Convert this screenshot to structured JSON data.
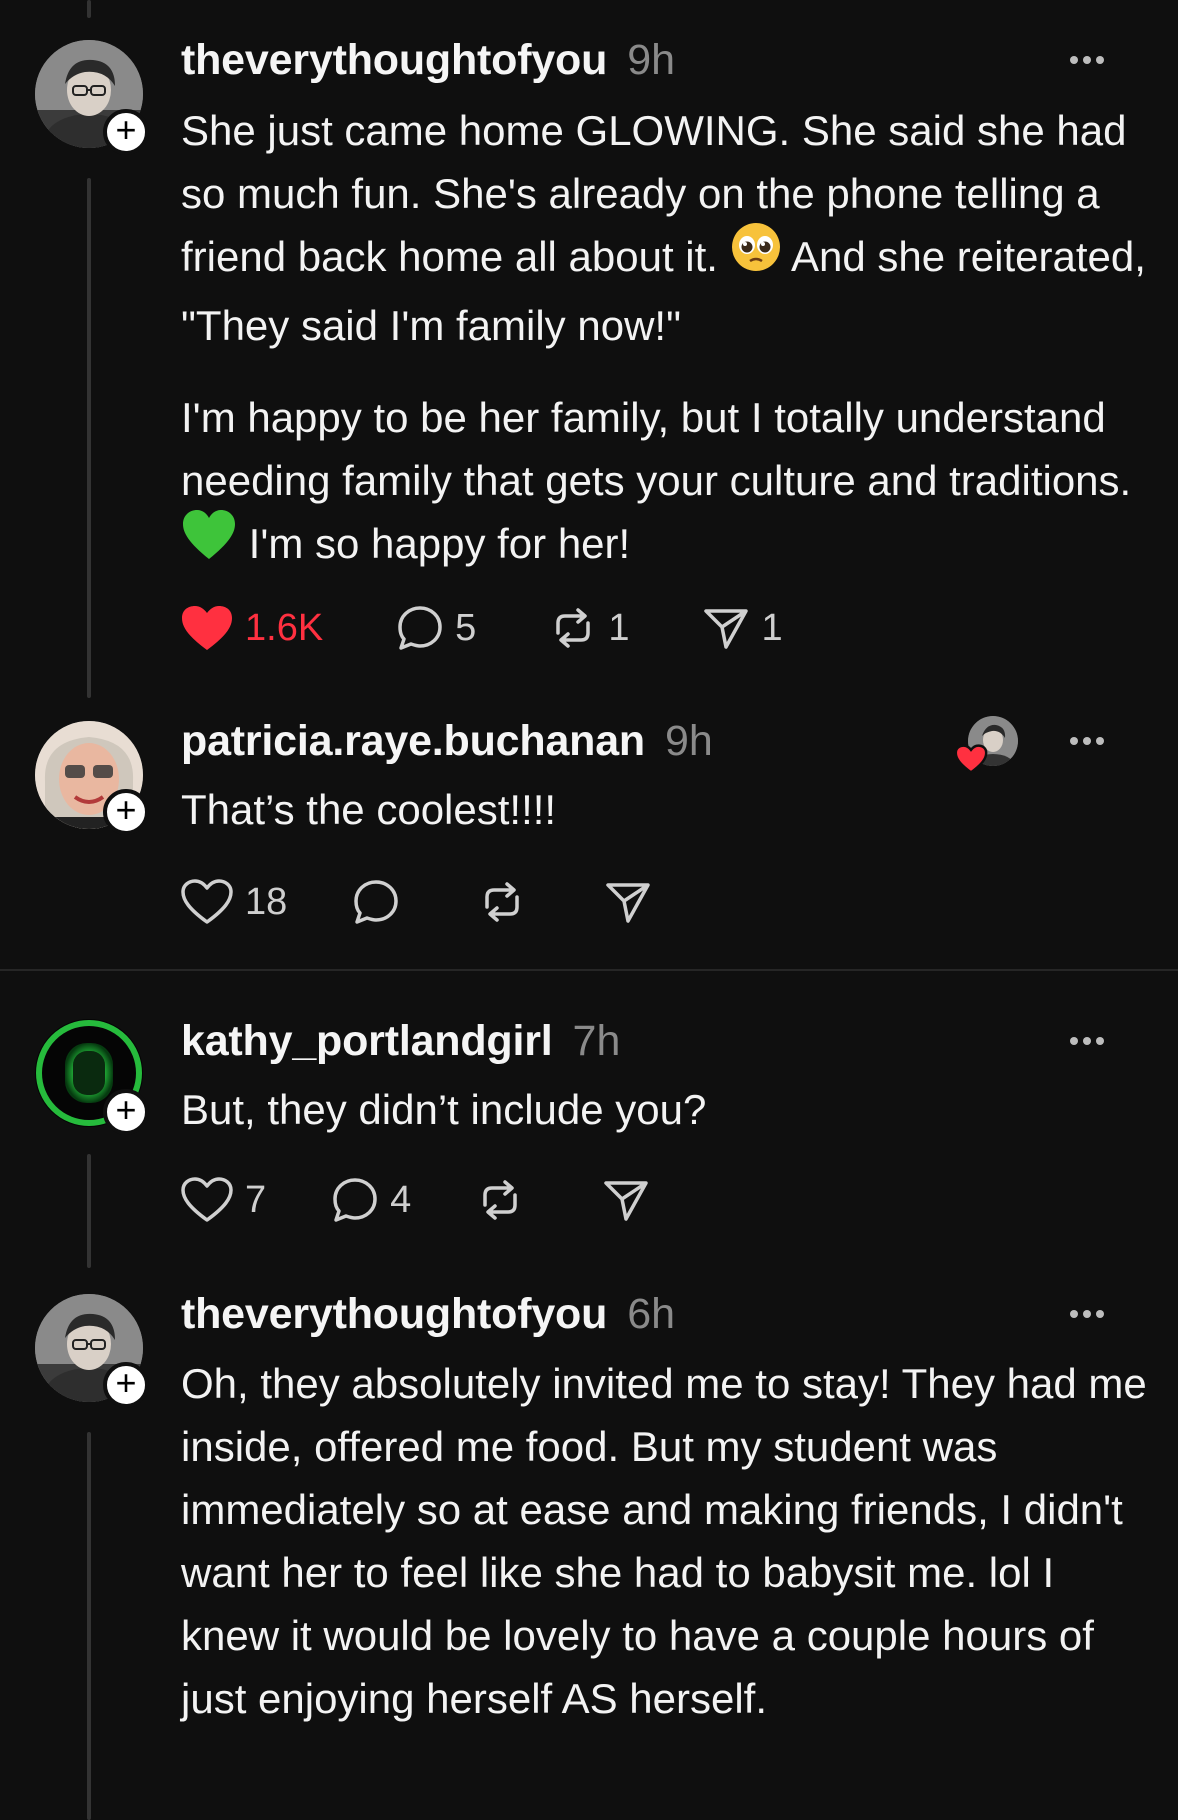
{
  "posts": [
    {
      "username": "theverythoughtofyou",
      "time": "9h",
      "avatar": "person-with-glasses-avatar",
      "paragraph1_a": "She just came home GLOWING. She said she had so much fun. She's already on the phone telling a friend back home all about it.",
      "paragraph1_emoji": "pleading-face-emoji",
      "paragraph1_b": " And she reiterated, \"They said I'm family now!\"",
      "paragraph2_a": "I'm happy to be her family, but I totally understand needing family that gets your culture and traditions.",
      "paragraph2_emoji": "green-heart-emoji",
      "paragraph2_b": " I'm so happy for her!",
      "likes": "1.6K",
      "liked": true,
      "replies": "5",
      "reposts": "1",
      "shares": "1"
    },
    {
      "username": "patricia.raye.buchanan",
      "time": "9h",
      "avatar": "woman-with-glasses-avatar",
      "text": "That’s the coolest!!!!",
      "likes": "18",
      "liked_by_author": true
    },
    {
      "username": "kathy_portlandgirl",
      "time": "7h",
      "avatar": "green-glow-avatar",
      "text": "But, they didn’t include you?",
      "likes": "7",
      "replies": "4"
    },
    {
      "username": "theverythoughtofyou",
      "time": "6h",
      "avatar": "person-with-glasses-avatar",
      "text": "Oh, they absolutely invited me to stay! They had me inside, offered me food. But my student was immediately so at ease and making friends, I didn't want her to feel like she had to babysit me. lol I knew it would be lovely to have a couple hours of just enjoying herself AS herself."
    }
  ],
  "colors": {
    "background": "#0f0f0f",
    "like_red": "#ff3040",
    "muted": "#8a8a8a",
    "green_heart": "#3ec43a"
  }
}
